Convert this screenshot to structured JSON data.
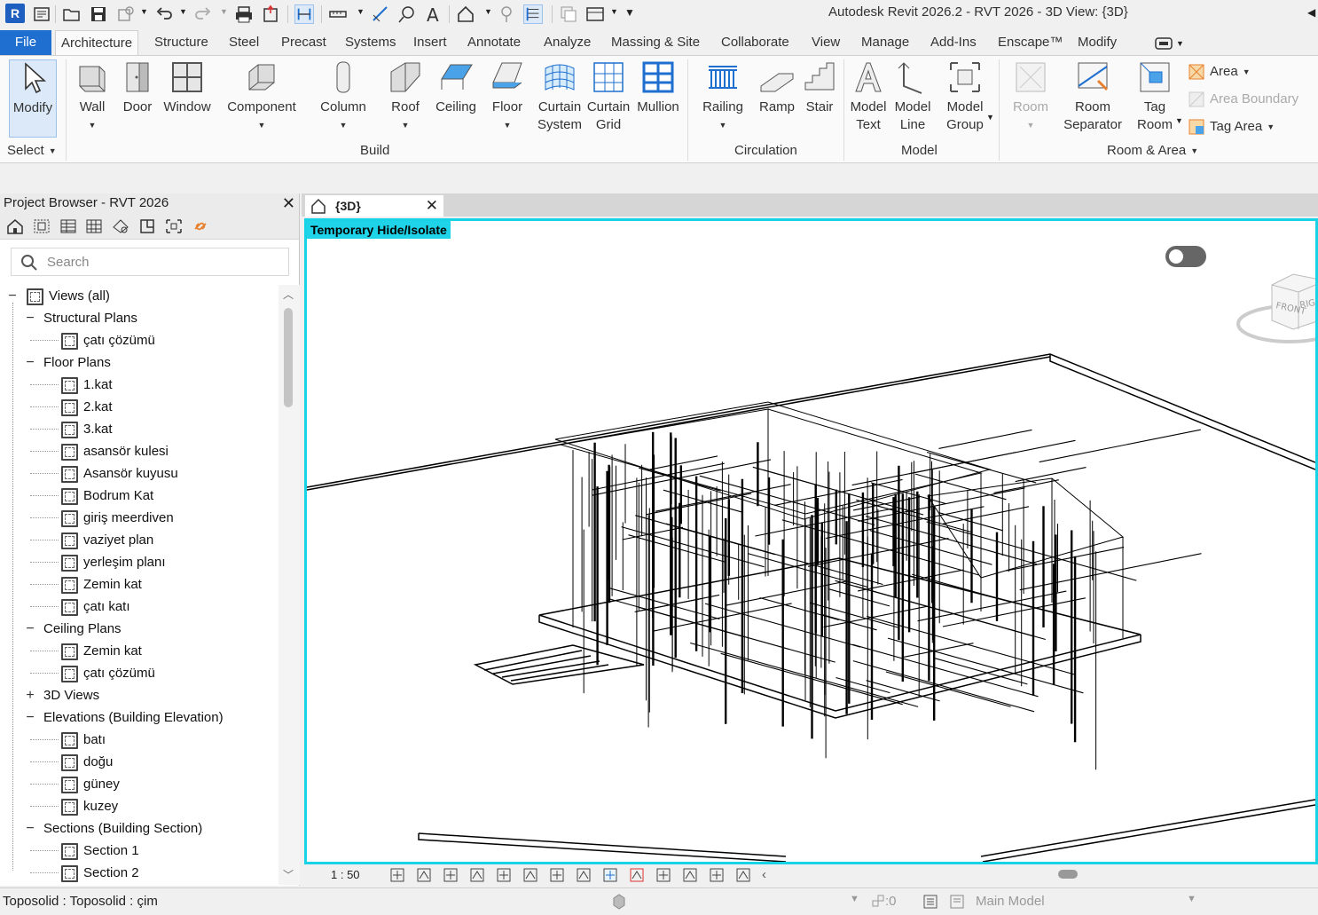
{
  "window_title": "Autodesk Revit 2026.2 - RVT 2026 - 3D View: {3D}",
  "app_icon_letter": "R",
  "tabs": [
    "File",
    "Architecture",
    "Structure",
    "Steel",
    "Precast",
    "Systems",
    "Insert",
    "Annotate",
    "Analyze",
    "Massing & Site",
    "Collaborate",
    "View",
    "Manage",
    "Add-Ins",
    "Enscape™",
    "Modify"
  ],
  "ribbon": {
    "modify": "Modify",
    "select": "Select",
    "build": {
      "label": "Build",
      "wall": "Wall",
      "door": "Door",
      "window": "Window",
      "component": "Component",
      "column": "Column",
      "roof": "Roof",
      "ceiling": "Ceiling",
      "floor": "Floor",
      "curtain_system": [
        "Curtain",
        "System"
      ],
      "curtain_grid": [
        "Curtain",
        "Grid"
      ],
      "mullion": "Mullion"
    },
    "circulation": {
      "label": "Circulation",
      "railing": "Railing",
      "ramp": "Ramp",
      "stair": "Stair"
    },
    "model": {
      "label": "Model",
      "model_text": [
        "Model",
        "Text"
      ],
      "model_line": [
        "Model",
        "Line"
      ],
      "model_group": [
        "Model",
        "Group"
      ]
    },
    "room_area": {
      "label": "Room & Area",
      "room": "Room",
      "room_separator": [
        "Room",
        "Separator"
      ],
      "tag_room": [
        "Tag",
        "Room"
      ],
      "area": "Area",
      "area_boundary": "Area  Boundary",
      "tag_area": "Tag  Area"
    }
  },
  "browser": {
    "title": "Project Browser - RVT 2026",
    "search_placeholder": "Search",
    "nodes": [
      {
        "label": "Views (all)",
        "level": 0,
        "toggle": "−"
      },
      {
        "label": "Structural Plans",
        "level": 1,
        "toggle": "−"
      },
      {
        "label": "çatı çözümü",
        "level": 2
      },
      {
        "label": "Floor Plans",
        "level": 1,
        "toggle": "−"
      },
      {
        "label": "1.kat",
        "level": 2
      },
      {
        "label": "2.kat",
        "level": 2
      },
      {
        "label": "3.kat",
        "level": 2
      },
      {
        "label": "asansör kulesi",
        "level": 2
      },
      {
        "label": "Asansör kuyusu",
        "level": 2
      },
      {
        "label": "Bodrum Kat",
        "level": 2
      },
      {
        "label": "giriş meerdiven",
        "level": 2
      },
      {
        "label": "vaziyet plan",
        "level": 2
      },
      {
        "label": "yerleşim planı",
        "level": 2
      },
      {
        "label": "Zemin kat",
        "level": 2
      },
      {
        "label": "çatı katı",
        "level": 2
      },
      {
        "label": "Ceiling Plans",
        "level": 1,
        "toggle": "−"
      },
      {
        "label": "Zemin kat",
        "level": 2
      },
      {
        "label": "çatı çözümü",
        "level": 2
      },
      {
        "label": "3D Views",
        "level": 1,
        "toggle": "+"
      },
      {
        "label": "Elevations (Building Elevation)",
        "level": 1,
        "toggle": "−"
      },
      {
        "label": "batı",
        "level": 2
      },
      {
        "label": "doğu",
        "level": 2
      },
      {
        "label": "güney",
        "level": 2
      },
      {
        "label": "kuzey",
        "level": 2
      },
      {
        "label": "Sections (Building Section)",
        "level": 1,
        "toggle": "−"
      },
      {
        "label": "Section 1",
        "level": 2
      },
      {
        "label": "Section 2",
        "level": 2
      }
    ]
  },
  "view": {
    "tab_label": "{3D}",
    "banner": "Temporary Hide/Isolate",
    "scale": "1 : 50",
    "viewcube_front": "FRONT",
    "viewcube_right": "RIGHT"
  },
  "status": {
    "selection": "Toposolid : Toposolid : çim",
    "count": ":0",
    "model": "Main Model"
  }
}
